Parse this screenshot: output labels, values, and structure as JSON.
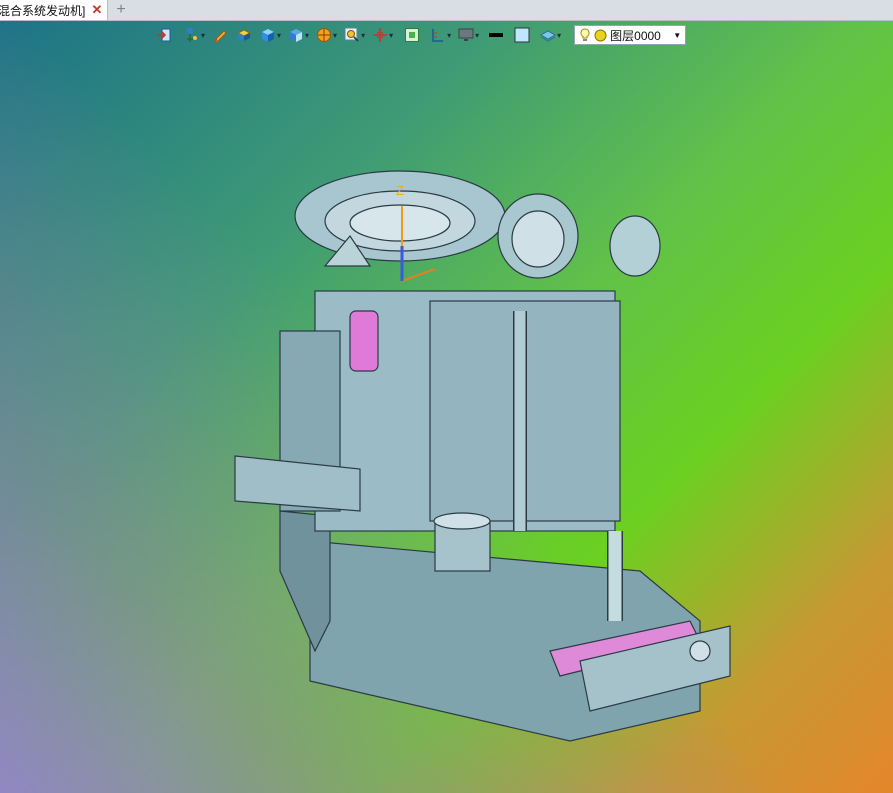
{
  "tab": {
    "title": "混合系统发动机]",
    "close_glyph": "✕",
    "add_glyph": "+"
  },
  "toolbar": {
    "icons": [
      "exit-view-icon",
      "pointer-icon",
      "pencil-icon",
      "box-stack-icon",
      "cube-icon",
      "view-cube-icon",
      "sphere-icon",
      "zoom-icon",
      "pan-icon",
      "fit-icon",
      "ruler-icon",
      "monitor-icon",
      "line-color-icon",
      "fill-color-icon",
      "layers-icon"
    ],
    "layer": {
      "value": "图层0000"
    }
  },
  "viewport": {
    "axis_label": "Z",
    "background_colors": [
      "#1d7387",
      "#6bd020",
      "#e4862a",
      "#9484c8"
    ]
  }
}
